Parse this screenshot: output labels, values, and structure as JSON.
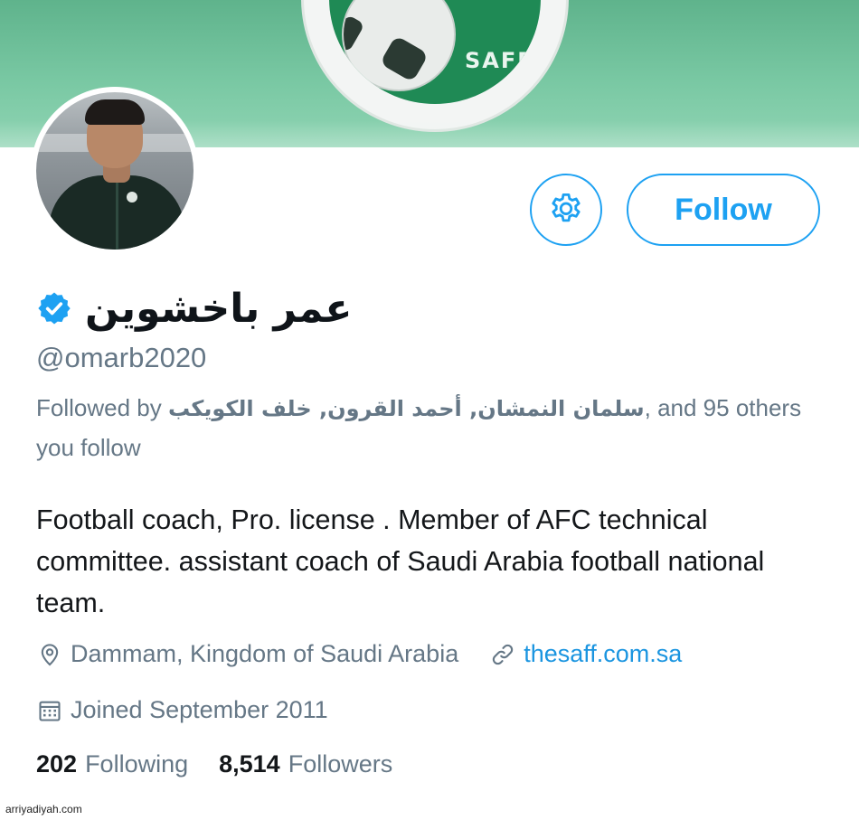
{
  "banner": {
    "logo_text": "SAFF",
    "colors": {
      "banner": "#79c8a3",
      "logo_green": "#1f8a55"
    }
  },
  "profile": {
    "display_name": "عمر باخشوين",
    "verified": true,
    "handle": "@omarb2020",
    "followed_by": {
      "prefix": "Followed by ",
      "names": "سلمان النمشان, أحمد القرون, خلف الكويكب",
      "suffix": ", and 95 others you follow"
    },
    "bio": "Football coach, Pro. license . Member of AFC technical committee. assistant coach of Saudi Arabia football national team.",
    "location": "Dammam, Kingdom of Saudi Arabia",
    "website": "thesaff.com.sa",
    "joined": "Joined September 2011",
    "stats": {
      "following_count": "202",
      "following_label": "Following",
      "followers_count": "8,514",
      "followers_label": "Followers"
    }
  },
  "actions": {
    "follow_label": "Follow",
    "settings_icon": "gear-icon"
  },
  "icons": {
    "verified": "verified-badge-icon",
    "location": "location-pin-icon",
    "link": "link-icon",
    "calendar": "calendar-icon"
  },
  "colors": {
    "accent": "#1da1f2",
    "link": "#1b95e0",
    "secondary_text": "#657786",
    "primary_text": "#14171a"
  },
  "watermark": "arriyadiyah.com"
}
